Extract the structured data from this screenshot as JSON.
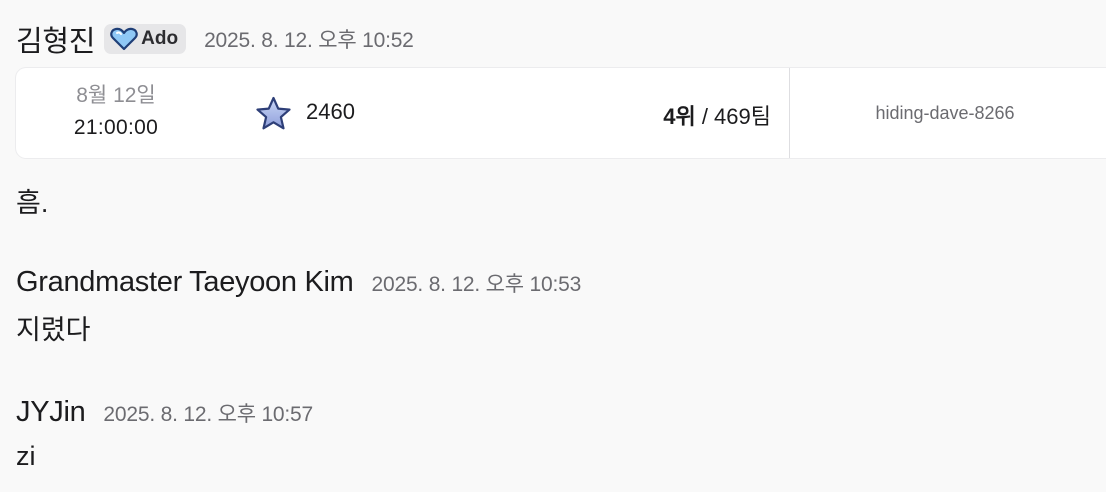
{
  "messages": [
    {
      "author": "김형진",
      "badge": {
        "icon": "blue-heart-icon",
        "label": "Ado"
      },
      "timestamp": "2025. 8. 12. 오후 10:52",
      "card": {
        "date": "8월 12일",
        "time": "21:00:00",
        "star_icon": "star-icon",
        "score": "2460",
        "rank_position": "4위",
        "rank_separator": " / ",
        "rank_total": "469팀",
        "team_name": "hiding-dave-8266"
      },
      "text": "흠."
    },
    {
      "author": "Grandmaster Taeyoon Kim",
      "timestamp": "2025. 8. 12. 오후 10:53",
      "text": "지렸다"
    },
    {
      "author": "JYJin",
      "timestamp": "2025. 8. 12. 오후 10:57",
      "text": "zi"
    }
  ],
  "colors": {
    "background": "#f9f9f9",
    "card": "#ffffff",
    "text": "#1c1c1e",
    "muted": "#6b6b70",
    "heart": "#8fc8f5",
    "star": "#a9b8ea"
  }
}
